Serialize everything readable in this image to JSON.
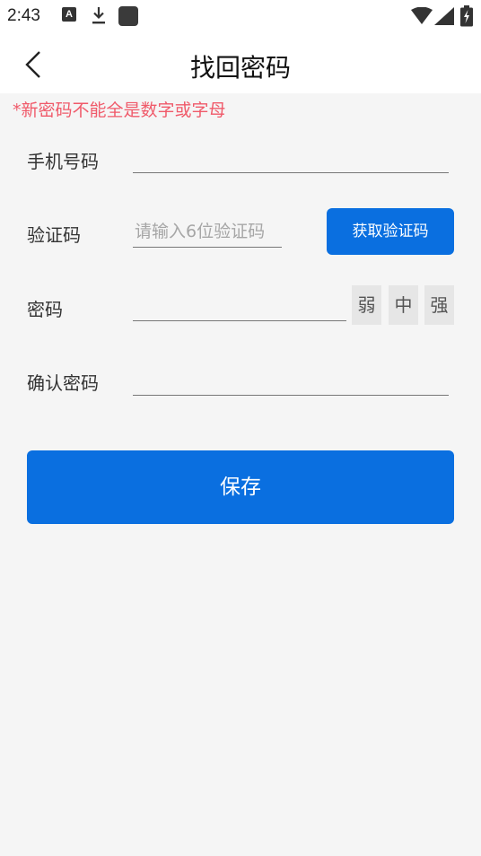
{
  "status_bar": {
    "time": "2:43",
    "notification_icon_label": "A",
    "icons": [
      "notification-a-icon",
      "download-icon",
      "app-square-icon",
      "wifi-icon",
      "signal-icon",
      "battery-charging-icon"
    ]
  },
  "header": {
    "back_icon": "chevron-left-icon",
    "title": "找回密码"
  },
  "hint": "*新密码不能全是数字或字母",
  "form": {
    "phone": {
      "label": "手机号码",
      "value": ""
    },
    "code": {
      "label": "验证码",
      "placeholder": "请输入6位验证码",
      "value": "",
      "button_label": "获取验证码"
    },
    "password": {
      "label": "密码",
      "value": "",
      "strength_levels": [
        "弱",
        "中",
        "强"
      ]
    },
    "confirm": {
      "label": "确认密码",
      "value": ""
    }
  },
  "save_button": {
    "label": "保存"
  },
  "colors": {
    "accent": "#0a6fe0",
    "hint": "#f05a6a",
    "background": "#f5f5f5",
    "strength_box": "#e6e6e6"
  }
}
